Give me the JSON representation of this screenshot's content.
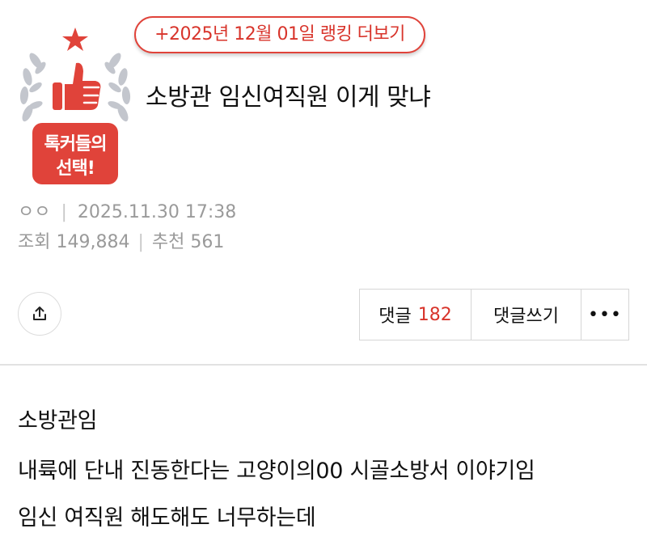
{
  "badge": {
    "line1": "톡커들의",
    "line2": "선택!",
    "colors": {
      "red": "#e0433a",
      "laurel": "#b9bcc4"
    }
  },
  "ranking_link": "+2025년 12월 01일 랭킹 더보기",
  "post": {
    "title": "소방관 임신여직원 이게 맞냐",
    "author": "ㅇㅇ",
    "datetime": "2025.11.30 17:38",
    "views_label": "조회",
    "views": "149,884",
    "recommend_label": "추천",
    "recommends": "561"
  },
  "actions": {
    "share_icon": "share-icon",
    "comments_label": "댓글",
    "comments_count": "182",
    "write_comment_label": "댓글쓰기",
    "more_label": "•••"
  },
  "body": {
    "lines": [
      "소방관임",
      "내륙에 단내 진동한다는 고양이의00 시골소방서 이야기임",
      "임신 여직원 해도해도 너무하는데"
    ]
  }
}
